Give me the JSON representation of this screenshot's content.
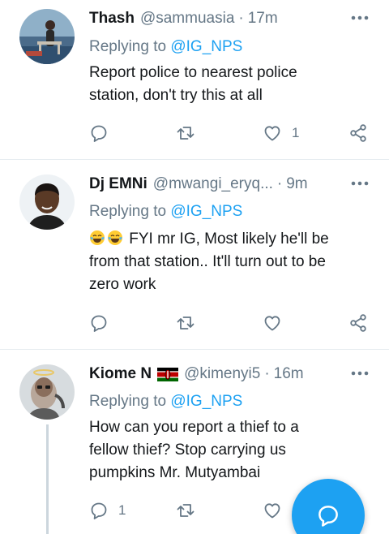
{
  "tweets": [
    {
      "name": "Thash",
      "handle": "@sammuasia",
      "dot": "·",
      "time": "17m",
      "replying_prefix": "Replying to ",
      "replying_to": "@IG_NPS",
      "lines": [
        "Report police to nearest police",
        "station,  don't try this at all"
      ],
      "reply_count": "",
      "retweet_count": "",
      "like_count": "1"
    },
    {
      "name": "Dj EMNi",
      "handle": "@mwangi_eryq...",
      "dot": "·",
      "time": "9m",
      "replying_prefix": "Replying to ",
      "replying_to": "@IG_NPS",
      "emoji": "tears-of-joy-emoji",
      "lines": [
        "FYI mr IG, Most likely he'll be",
        "from that station.. It'll turn out to be",
        "zero work"
      ],
      "reply_count": "",
      "retweet_count": "",
      "like_count": ""
    },
    {
      "name": "Kiome N",
      "flag": "kenya-flag-emoji",
      "handle": "@kimenyi5",
      "dot": "·",
      "time": "16m",
      "replying_prefix": "Replying to ",
      "replying_to": "@IG_NPS",
      "lines": [
        "How can you report a thief to a",
        "fellow thief? Stop carrying us",
        "pumpkins Mr. Mutyambai"
      ],
      "reply_count": "1",
      "retweet_count": "",
      "like_count": ""
    }
  ],
  "icons": {
    "reply": "reply-icon",
    "retweet": "retweet-icon",
    "like": "heart-icon",
    "share": "share-icon",
    "more": "more-options-icon",
    "compose": "compose-reply-icon"
  },
  "colors": {
    "accent": "#1da1f2",
    "secondary_text": "#657786",
    "divider": "#e6ecf0"
  }
}
